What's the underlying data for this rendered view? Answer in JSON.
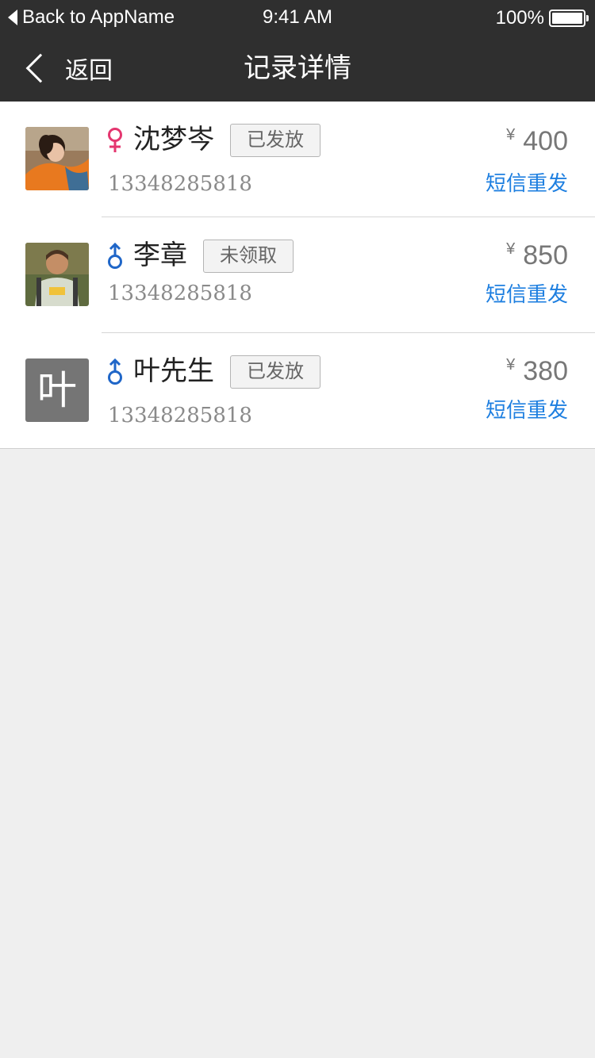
{
  "status_bar": {
    "back_app": "Back to AppName",
    "time": "9:41 AM",
    "battery": "100%"
  },
  "nav": {
    "back_label": "返回",
    "title": "记录详情"
  },
  "records": [
    {
      "name": "沈梦岑",
      "gender": "female",
      "status": "已发放",
      "phone": "13348285818",
      "currency": "¥",
      "amount": "400",
      "resend": "短信重发"
    },
    {
      "name": "李章",
      "gender": "male",
      "status": "未领取",
      "phone": "13348285818",
      "currency": "¥",
      "amount": "850",
      "resend": "短信重发"
    },
    {
      "name": "叶先生",
      "gender": "male",
      "status": "已发放",
      "phone": "13348285818",
      "currency": "¥",
      "amount": "380",
      "resend": "短信重发",
      "avatar_initial": "叶"
    }
  ],
  "colors": {
    "topbar": "#2f2f2f",
    "female": "#e4366f",
    "male": "#1f66c8",
    "link": "#1e7fe0"
  }
}
